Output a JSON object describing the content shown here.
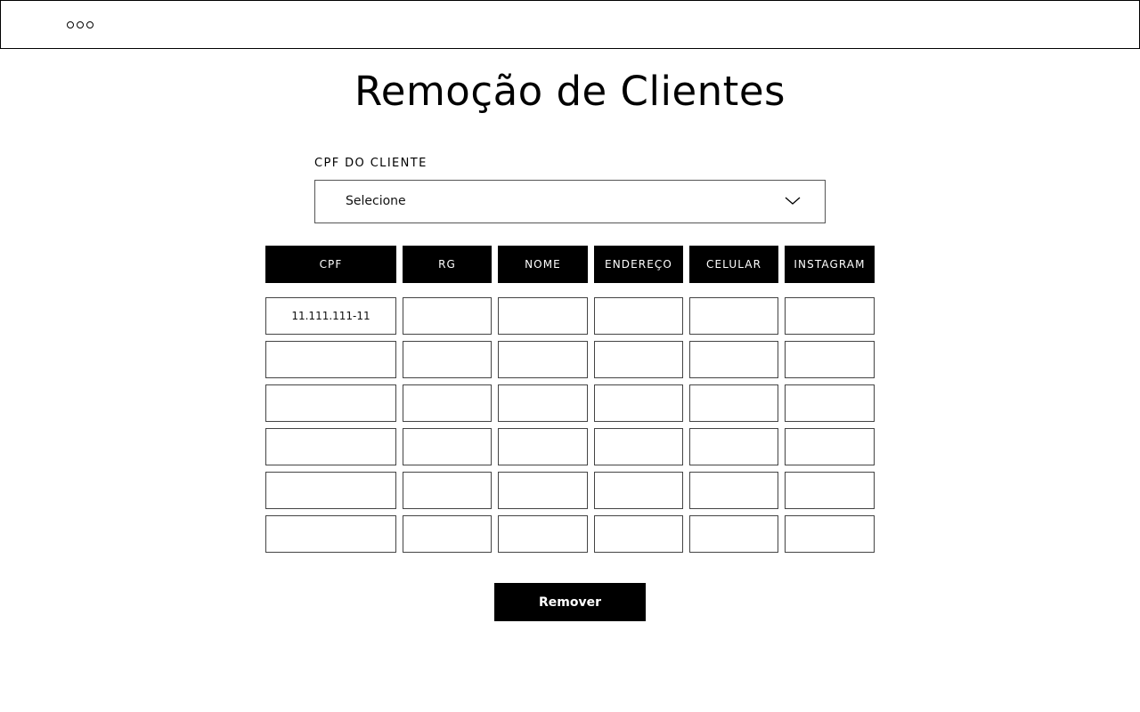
{
  "header": {
    "menu_icon": "more-dots-icon"
  },
  "page": {
    "title": "Remoção de Clientes"
  },
  "client_select": {
    "label": "CPF DO CLIENTE",
    "value": "Selecione",
    "icon": "chevron-down-icon"
  },
  "table": {
    "columns": [
      "CPF",
      "RG",
      "NOME",
      "ENDEREÇO",
      "CELULAR",
      "INSTAGRAM"
    ],
    "rows": [
      [
        "11.111.111-11",
        "",
        "",
        "",
        "",
        ""
      ],
      [
        "",
        "",
        "",
        "",
        "",
        ""
      ],
      [
        "",
        "",
        "",
        "",
        "",
        ""
      ],
      [
        "",
        "",
        "",
        "",
        "",
        ""
      ],
      [
        "",
        "",
        "",
        "",
        "",
        ""
      ],
      [
        "",
        "",
        "",
        "",
        "",
        ""
      ]
    ]
  },
  "actions": {
    "remove_label": "Remover"
  }
}
